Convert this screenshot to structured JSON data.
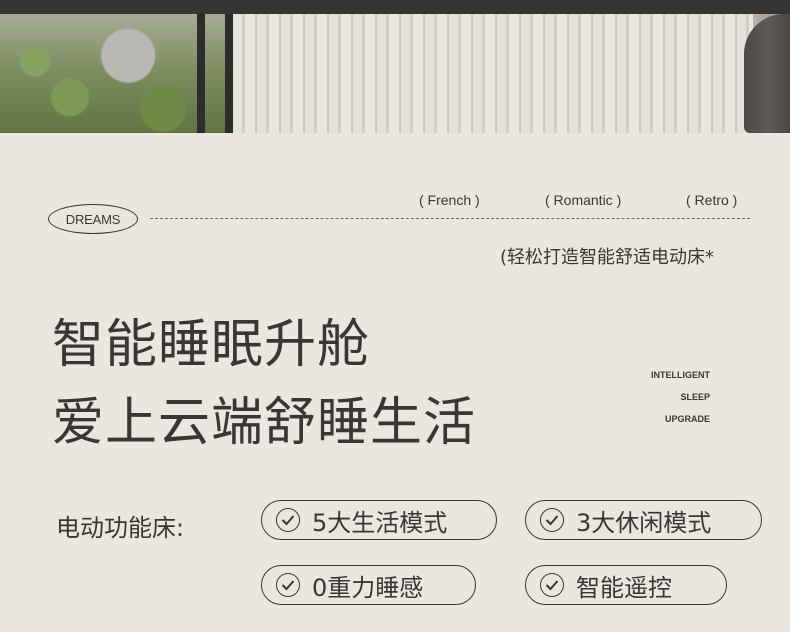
{
  "tags": {
    "dreams": "DREAMS",
    "french": "( French )",
    "romantic": "( Romantic )",
    "retro": "( Retro )"
  },
  "subtitle": "(轻松打造智能舒适电动床*",
  "headline": {
    "line1": "智能睡眠升舱",
    "line2": "爱上云端舒睡生活"
  },
  "english_tagline": [
    "INTELLIGENT",
    "SLEEP",
    "UPGRADE"
  ],
  "functions": {
    "label": "电动功能床:",
    "items": [
      "5大生活模式",
      "3大休闲模式",
      "0重力睡感",
      "智能遥控"
    ]
  },
  "icons": {
    "feature": "check-circle-icon"
  },
  "colors": {
    "background": "#ebe6df",
    "text": "#3a3633"
  }
}
